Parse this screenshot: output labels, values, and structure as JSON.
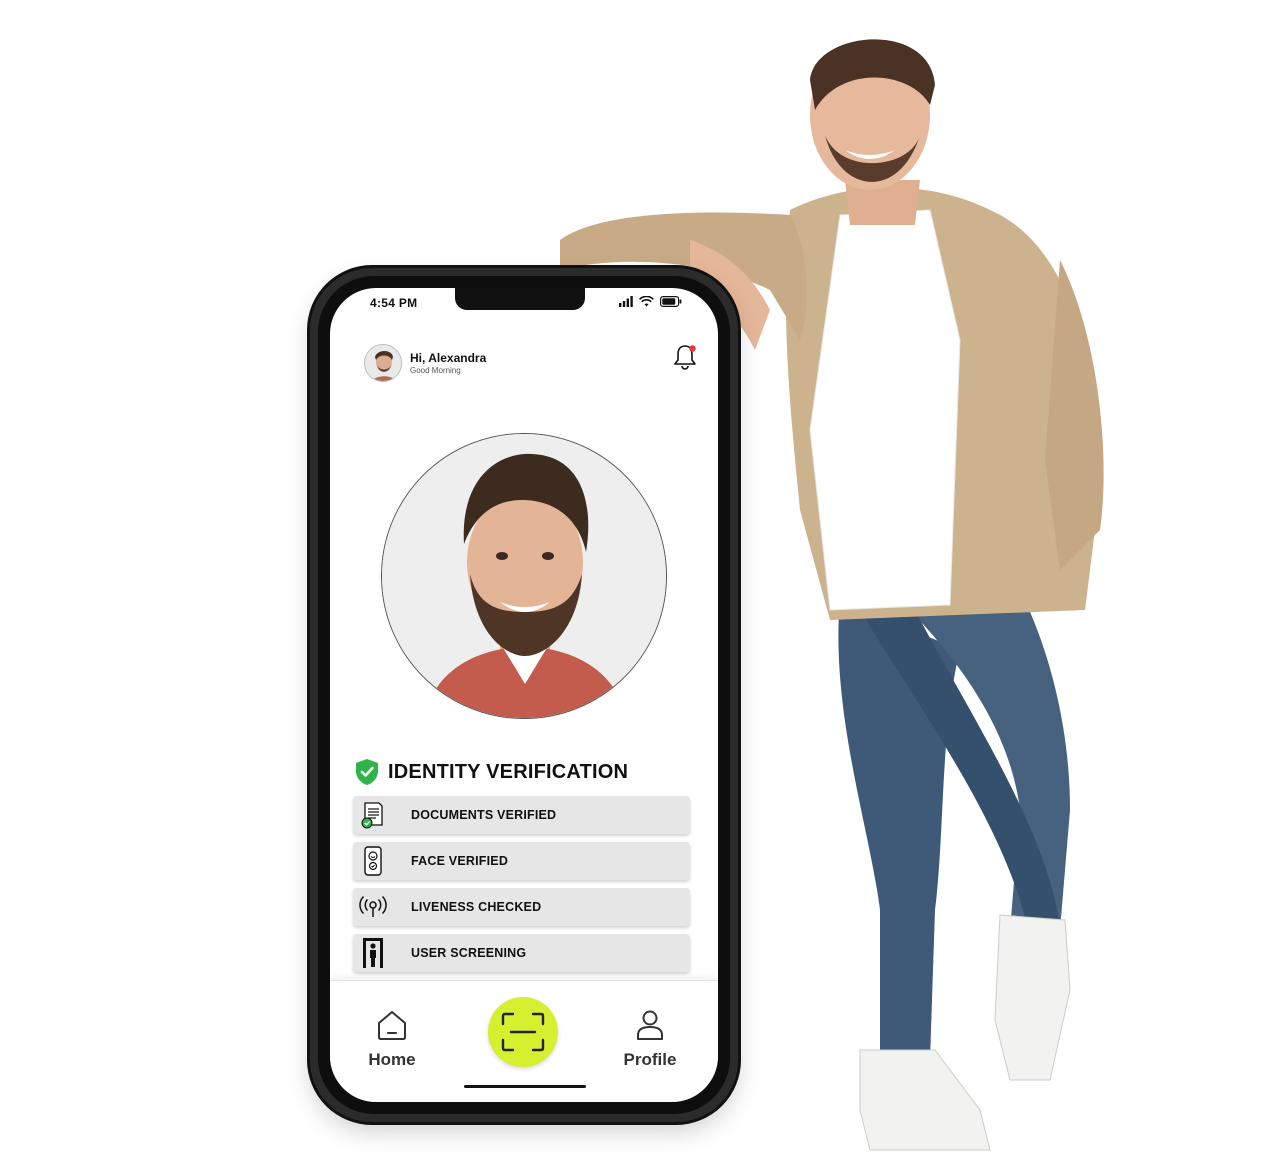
{
  "status_bar": {
    "time": "4:54 PM"
  },
  "header": {
    "greeting": "Hi, Alexandra",
    "subtitle": "Good Morning",
    "icons": {
      "avatar": "user-avatar",
      "notification": "bell-icon"
    },
    "notification_dot_color": "#e53935"
  },
  "verification": {
    "title": "IDENTITY VERIFICATION",
    "shield_color": "#2fb34a",
    "items": [
      {
        "label": "DOCUMENTS VERIFIED",
        "icon": "document-check-icon"
      },
      {
        "label": "FACE VERIFIED",
        "icon": "phone-face-icon"
      },
      {
        "label": "LIVENESS CHECKED",
        "icon": "signal-icon"
      },
      {
        "label": "USER SCREENING",
        "icon": "body-scan-icon"
      }
    ]
  },
  "bottom_nav": {
    "home_label": "Home",
    "profile_label": "Profile",
    "scan_icon": "scan-frame-icon",
    "scan_color": "#d6ef2f"
  }
}
